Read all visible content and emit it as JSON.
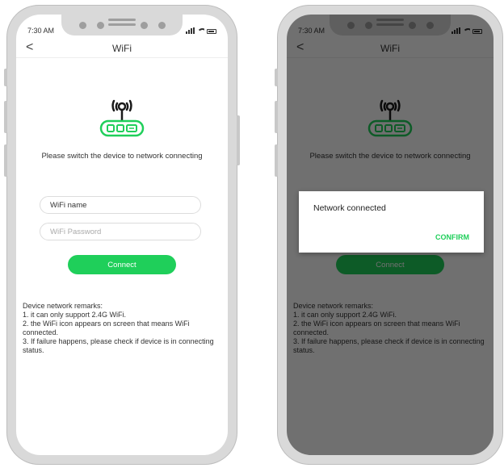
{
  "status": {
    "time": "7:30 AM"
  },
  "nav": {
    "back_glyph": "<",
    "title": "WiFi"
  },
  "instruction": "Please switch the device to network connecting",
  "form": {
    "wifi_name_value": "WiFi name",
    "wifi_password_placeholder": "WiFi Password",
    "connect_label": "Connect"
  },
  "remarks": [
    "Device network remarks:",
    "1. it can only support 2.4G WiFi.",
    "2. the WiFi icon appears on screen that means WiFi connected.",
    "3. If failure happens, please check if device is in connecting status."
  ],
  "dialog": {
    "message": "Network connected",
    "confirm_label": "CONFIRM"
  },
  "icons": [
    "router-wifi-icon",
    "back-arrow-icon",
    "signal-icon",
    "wifi-status-icon",
    "battery-icon"
  ],
  "colors": {
    "accent": "#1fcf5a",
    "overlay": "rgba(0,0,0,0.56)",
    "phone_frame": "#d9d9d9"
  }
}
